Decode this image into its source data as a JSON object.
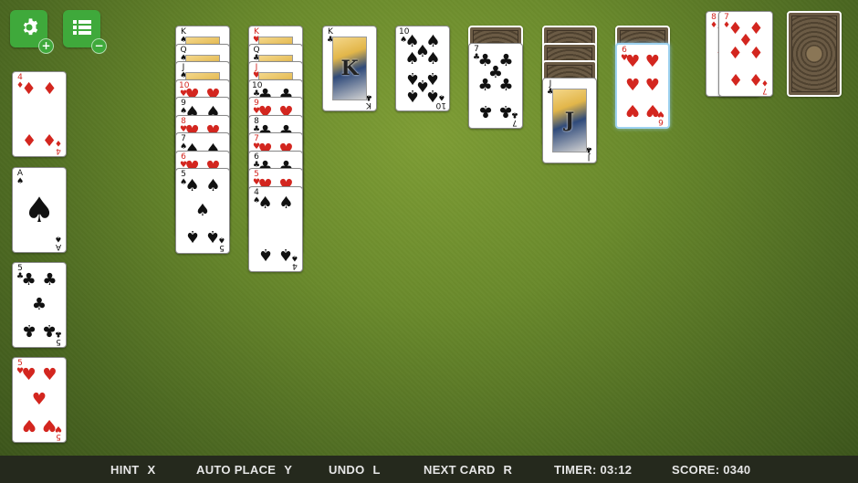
{
  "toolbar": {
    "settings_badge": "+",
    "menu_badge": "−"
  },
  "status_bar": {
    "hint_label": "HINT",
    "hint_key": "X",
    "auto_place_label": "AUTO PLACE",
    "auto_place_key": "Y",
    "undo_label": "UNDO",
    "undo_key": "L",
    "next_card_label": "NEXT CARD",
    "next_card_key": "R",
    "timer_label": "TIMER:",
    "timer_value": "03:12",
    "score_label": "SCORE:",
    "score_value": "0340"
  },
  "free_cells": [
    {
      "rank": "4",
      "suit": "♦",
      "color": "red"
    },
    {
      "rank": "A",
      "suit": "♠",
      "color": "black"
    },
    {
      "rank": "5",
      "suit": "♣",
      "color": "black"
    },
    {
      "rank": "5",
      "suit": "♥",
      "color": "red"
    }
  ],
  "tableau": [
    {
      "down": 0,
      "up": [
        {
          "rank": "K",
          "suit": "♠",
          "color": "black"
        },
        {
          "rank": "Q",
          "suit": "♠",
          "color": "black"
        },
        {
          "rank": "J",
          "suit": "♠",
          "color": "black"
        },
        {
          "rank": "10",
          "suit": "♥",
          "color": "red"
        },
        {
          "rank": "9",
          "suit": "♠",
          "color": "black"
        },
        {
          "rank": "8",
          "suit": "♥",
          "color": "red"
        },
        {
          "rank": "7",
          "suit": "♠",
          "color": "black"
        },
        {
          "rank": "6",
          "suit": "♥",
          "color": "red"
        },
        {
          "rank": "5",
          "suit": "♠",
          "color": "black"
        }
      ]
    },
    {
      "down": 0,
      "up": [
        {
          "rank": "K",
          "suit": "♥",
          "color": "red"
        },
        {
          "rank": "Q",
          "suit": "♣",
          "color": "black"
        },
        {
          "rank": "J",
          "suit": "♥",
          "color": "red"
        },
        {
          "rank": "10",
          "suit": "♣",
          "color": "black"
        },
        {
          "rank": "9",
          "suit": "♥",
          "color": "red"
        },
        {
          "rank": "8",
          "suit": "♣",
          "color": "black"
        },
        {
          "rank": "7",
          "suit": "♥",
          "color": "red"
        },
        {
          "rank": "6",
          "suit": "♣",
          "color": "black"
        },
        {
          "rank": "5",
          "suit": "♥",
          "color": "red"
        },
        {
          "rank": "4",
          "suit": "♠",
          "color": "black"
        }
      ]
    },
    {
      "down": 0,
      "up": [
        {
          "rank": "K",
          "suit": "♣",
          "color": "black"
        }
      ]
    },
    {
      "down": 0,
      "up": [
        {
          "rank": "10",
          "suit": "♠",
          "color": "black"
        }
      ]
    },
    {
      "down": 1,
      "up": [
        {
          "rank": "7",
          "suit": "♣",
          "color": "black"
        }
      ]
    },
    {
      "down": 3,
      "up": [
        {
          "rank": "J",
          "suit": "♣",
          "color": "black"
        }
      ]
    },
    {
      "down": 1,
      "up": [
        {
          "rank": "6",
          "suit": "♥",
          "color": "red",
          "selected": true
        }
      ]
    }
  ],
  "waste": [
    {
      "rank": "8",
      "suit": "♦",
      "color": "red"
    },
    {
      "rank": "7",
      "suit": "♦",
      "color": "red"
    }
  ],
  "stock": {
    "count": 1
  }
}
